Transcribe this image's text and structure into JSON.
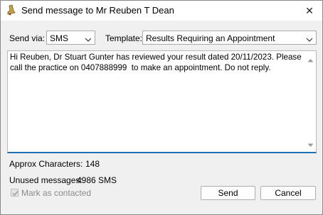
{
  "window": {
    "title": "Send message to Mr Reuben T Dean",
    "app_icon": "bell-icon",
    "close_glyph": "✕"
  },
  "form": {
    "send_via_label": "Send via:",
    "send_via_value": "SMS",
    "template_label": "Template:",
    "template_value": "Results Requiring an Appointment"
  },
  "message": {
    "text": "Hi Reuben, Dr Stuart Gunter has reviewed your result dated 20/11/2023. Please call the practice on 0407888999  to make an appointment. Do not reply."
  },
  "stats": {
    "approx_chars_label": "Approx Characters:",
    "approx_chars_value": "148",
    "unused_label": "Unused messages:",
    "unused_value": "4986 SMS"
  },
  "options": {
    "mark_contacted_label": "Mark as contacted",
    "mark_contacted_checked": true,
    "mark_contacted_enabled": false
  },
  "buttons": {
    "send": "Send",
    "cancel": "Cancel"
  },
  "colors": {
    "accent_underline": "#1f6fb5",
    "disabled_text": "#8c8c8c",
    "app_icon": "#c8a24a"
  }
}
